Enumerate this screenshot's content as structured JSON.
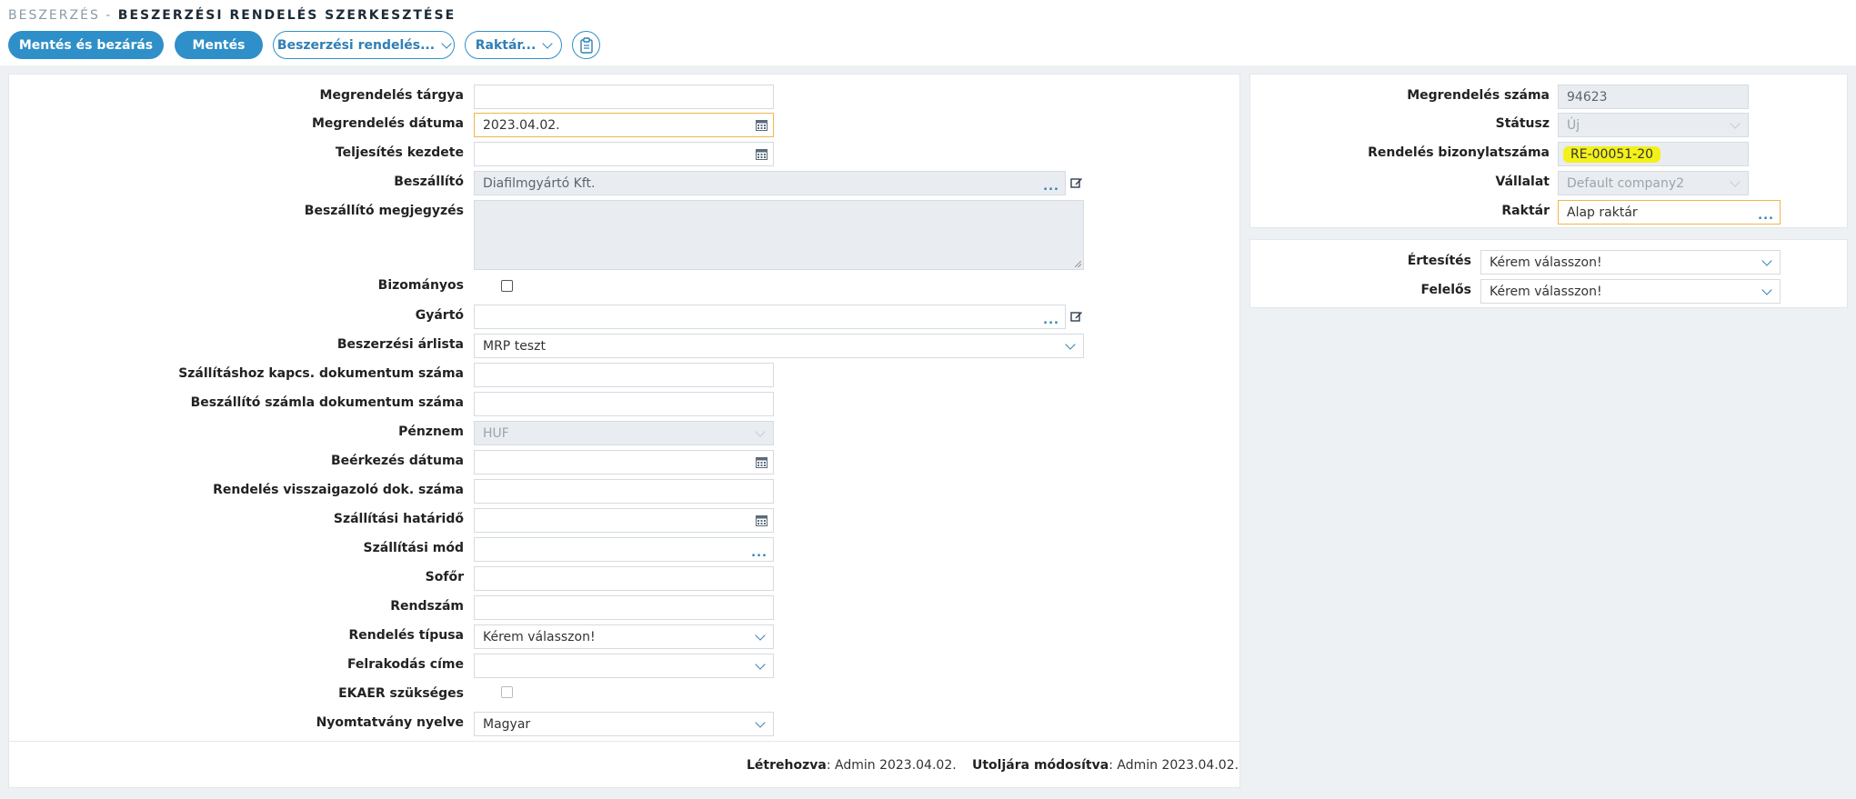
{
  "header": {
    "breadcrumb": "BESZERZÉS",
    "separator": " - ",
    "title": "BESZERZÉSI RENDELÉS SZERKESZTÉSE"
  },
  "toolbar": {
    "save_close": "Mentés és bezárás",
    "save": "Mentés",
    "purchase_order_menu": "Beszerzési rendelés...",
    "warehouse_menu": "Raktár...",
    "clipboard_icon": "clipboard-icon"
  },
  "form": {
    "subject_label": "Megrendelés tárgya",
    "subject_value": "",
    "order_date_label": "Megrendelés dátuma",
    "order_date_value": "2023.04.02.",
    "fulfillment_start_label": "Teljesítés kezdete",
    "fulfillment_start_value": "",
    "supplier_label": "Beszállító",
    "supplier_value": "Diafilmgyártó Kft.",
    "supplier_note_label": "Beszállító megjegyzés",
    "supplier_note_value": "",
    "consignment_label": "Bizományos",
    "consignment_checked": false,
    "manufacturer_label": "Gyártó",
    "manufacturer_value": "",
    "price_list_label": "Beszerzési árlista",
    "price_list_value": "MRP teszt",
    "delivery_doc_label": "Szállításhoz kapcs. dokumentum száma",
    "delivery_doc_value": "",
    "supplier_invoice_label": "Beszállító számla dokumentum száma",
    "supplier_invoice_value": "",
    "currency_label": "Pénznem",
    "currency_value": "HUF",
    "arrival_date_label": "Beérkezés dátuma",
    "arrival_date_value": "",
    "order_confirm_label": "Rendelés visszaigazoló dok. száma",
    "order_confirm_value": "",
    "delivery_deadline_label": "Szállítási határidő",
    "delivery_deadline_value": "",
    "delivery_method_label": "Szállítási mód",
    "delivery_method_value": "",
    "driver_label": "Sofőr",
    "driver_value": "",
    "plate_label": "Rendszám",
    "plate_value": "",
    "order_type_label": "Rendelés típusa",
    "order_type_value": "Kérem válasszon!",
    "loading_address_label": "Felrakodás címe",
    "loading_address_value": "",
    "ekaer_label": "EKAER szükséges",
    "ekaer_checked": false,
    "print_language_label": "Nyomtatvány nyelve",
    "print_language_value": "Magyar"
  },
  "info": {
    "order_number_label": "Megrendelés száma",
    "order_number_value": "94623",
    "status_label": "Státusz",
    "status_value": "Új",
    "doc_number_label": "Rendelés bizonylatszáma",
    "doc_number_value": "RE-00051-20",
    "company_label": "Vállalat",
    "company_value": "Default company2",
    "warehouse_label": "Raktár",
    "warehouse_value": "Alap raktár"
  },
  "notify": {
    "notify_label": "Értesítés",
    "notify_value": "Kérem válasszon!",
    "owner_label": "Felelős",
    "owner_value": "Kérem válasszon!"
  },
  "footer": {
    "created_label": "Létrehozva",
    "created_value": ": Admin 2023.04.02.",
    "modified_label": "Utoljára módosítva",
    "modified_value": ": Admin 2023.04.02."
  },
  "colors": {
    "accent": "#2f8fc8",
    "focus": "#f1b64b",
    "highlight": "#f4f01a",
    "disabled_bg": "#e9edf1"
  }
}
